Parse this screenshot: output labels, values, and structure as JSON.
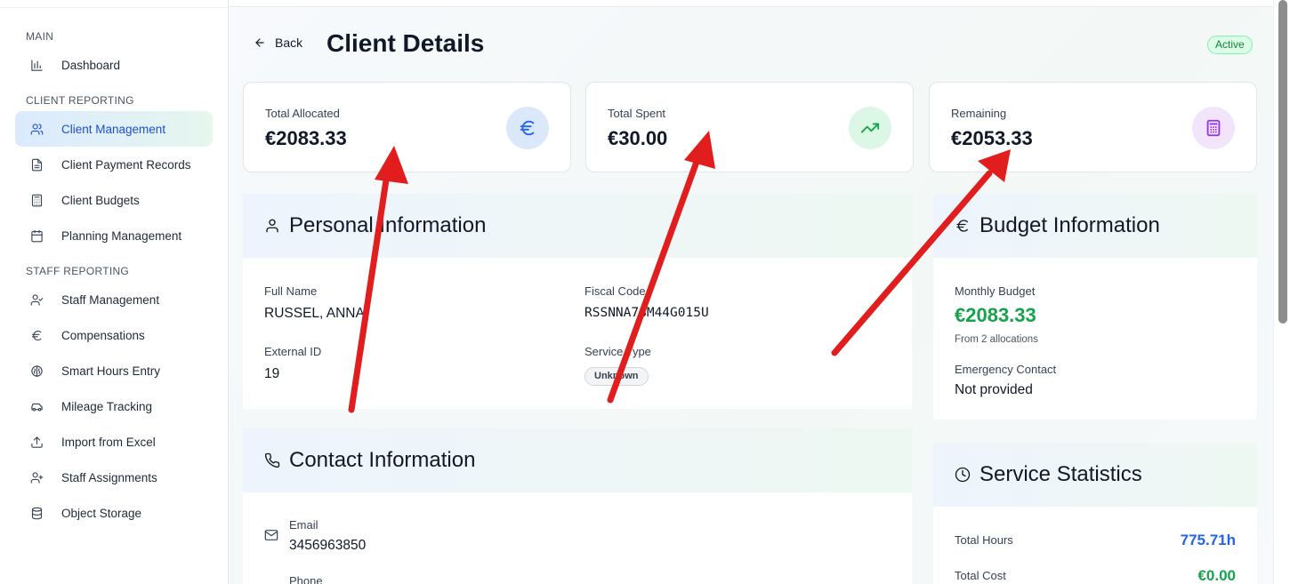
{
  "sidebar": {
    "sections": [
      {
        "label": "MAIN",
        "items": [
          {
            "label": "Dashboard",
            "icon": "bar-chart-icon"
          }
        ]
      },
      {
        "label": "CLIENT REPORTING",
        "items": [
          {
            "label": "Client Management",
            "icon": "users-icon",
            "active": true
          },
          {
            "label": "Client Payment Records",
            "icon": "file-text-icon"
          },
          {
            "label": "Client Budgets",
            "icon": "calculator-icon"
          },
          {
            "label": "Planning Management",
            "icon": "calendar-icon"
          }
        ]
      },
      {
        "label": "STAFF REPORTING",
        "items": [
          {
            "label": "Staff Management",
            "icon": "user-check-icon"
          },
          {
            "label": "Compensations",
            "icon": "euro-icon"
          },
          {
            "label": "Smart Hours Entry",
            "icon": "brain-icon"
          },
          {
            "label": "Mileage Tracking",
            "icon": "car-icon"
          },
          {
            "label": "Import from Excel",
            "icon": "upload-icon"
          },
          {
            "label": "Staff Assignments",
            "icon": "user-plus-icon"
          },
          {
            "label": "Object Storage",
            "icon": "database-icon"
          }
        ]
      }
    ]
  },
  "header": {
    "back_label": "Back",
    "title": "Client Details",
    "status": "Active"
  },
  "stats": [
    {
      "label": "Total Allocated",
      "value": "€2083.33",
      "icon": "euro-icon",
      "bg": "#dbe8fb",
      "fg": "#2563eb"
    },
    {
      "label": "Total Spent",
      "value": "€30.00",
      "icon": "trending-up-icon",
      "bg": "#dcf7e6",
      "fg": "#16a34a"
    },
    {
      "label": "Remaining",
      "value": "€2053.33",
      "icon": "calculator-icon",
      "bg": "#f1e4fb",
      "fg": "#9333ea"
    }
  ],
  "personal": {
    "title": "Personal Information",
    "full_name_label": "Full Name",
    "full_name": "RUSSEL, ANNA",
    "fiscal_code_label": "Fiscal Code",
    "fiscal_code": "RSSNNA78M44G015U",
    "external_id_label": "External ID",
    "external_id": "19",
    "service_type_label": "Service Type",
    "service_type": "Unknown"
  },
  "contact": {
    "title": "Contact Information",
    "email_label": "Email",
    "email": "3456963850",
    "phone_label": "Phone"
  },
  "budget": {
    "title": "Budget Information",
    "monthly_label": "Monthly Budget",
    "monthly_value": "€2083.33",
    "allocations_note": "From 2 allocations",
    "emergency_label": "Emergency Contact",
    "emergency_value": "Not provided"
  },
  "service_stats": {
    "title": "Service Statistics",
    "hours_label": "Total Hours",
    "hours_value": "775.71h",
    "cost_label": "Total Cost",
    "cost_value": "€0.00"
  },
  "colors": {
    "accent_blue": "#2563eb",
    "accent_green": "#16a34a",
    "annotation_red": "#e11d1d"
  }
}
